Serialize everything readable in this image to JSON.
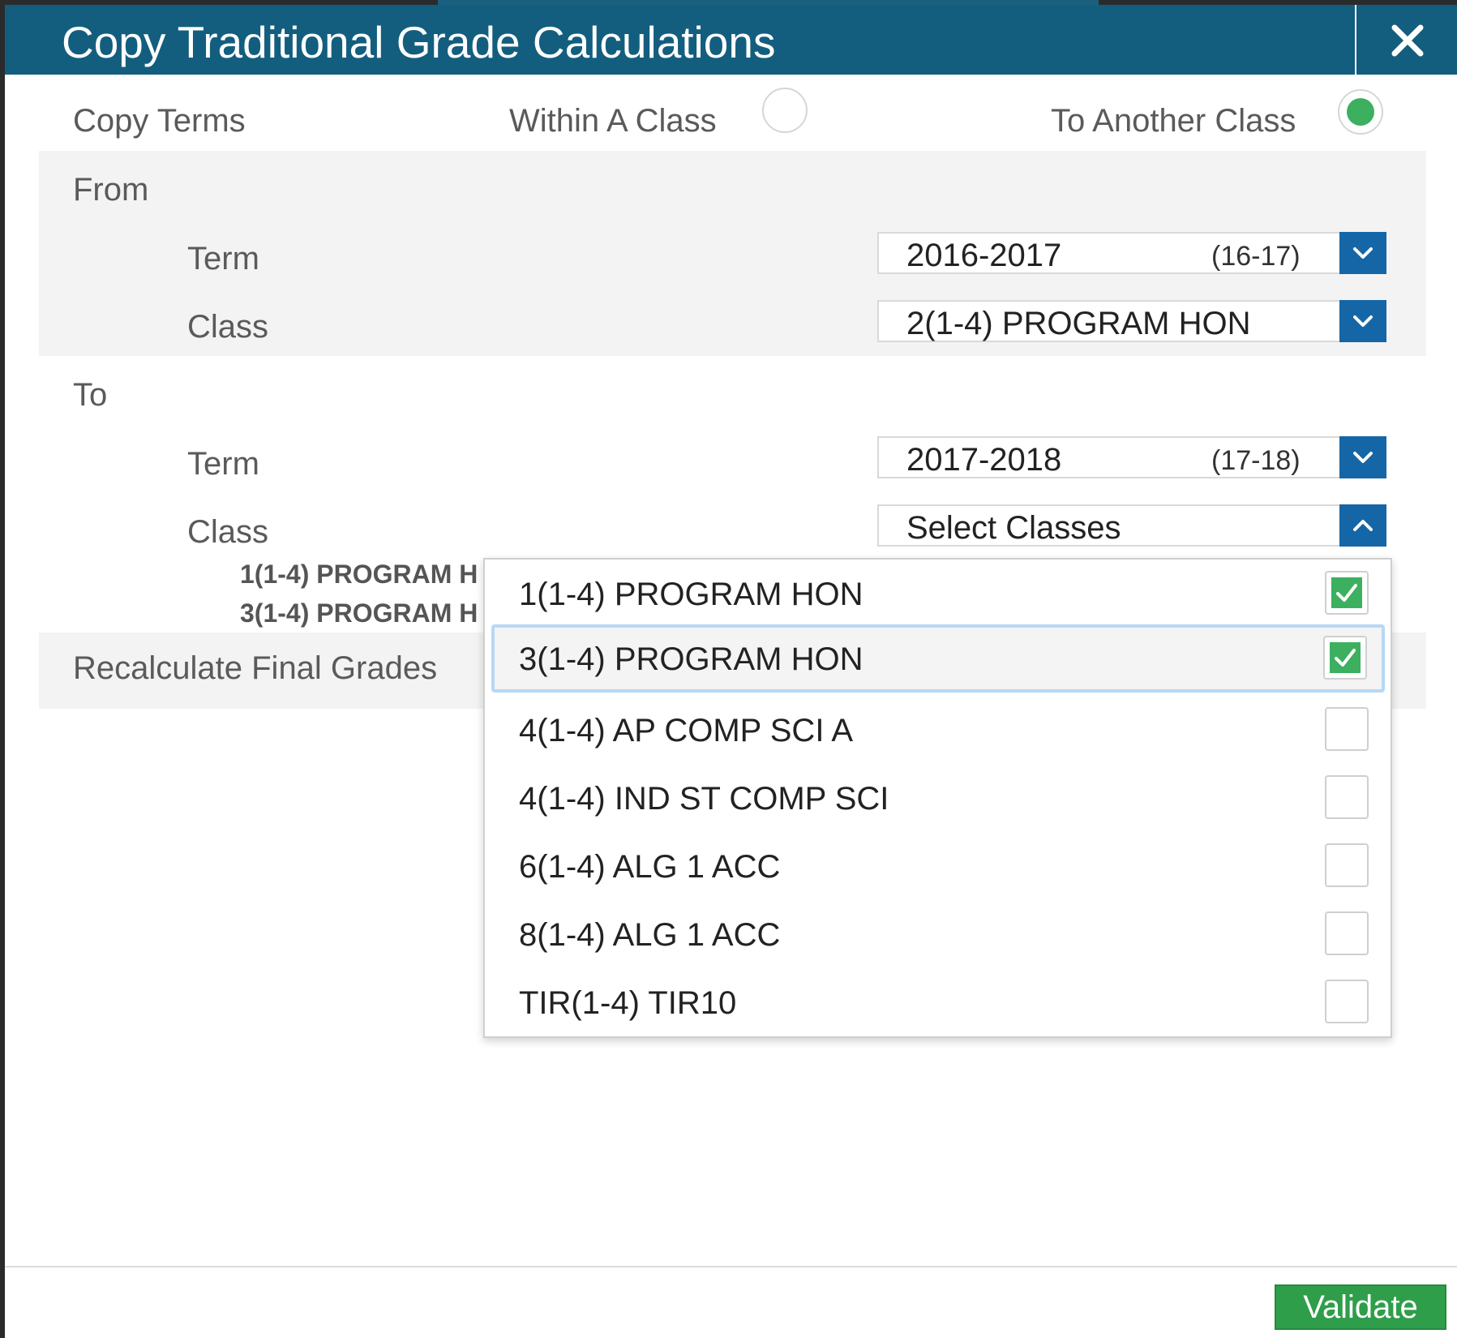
{
  "dialog": {
    "title": "Copy Traditional Grade Calculations",
    "copy_terms_label": "Copy Terms",
    "within_class_label": "Within A Class",
    "another_class_label": "To Another Class",
    "within_class_selected": false,
    "another_class_selected": true
  },
  "from": {
    "heading": "From",
    "term_label": "Term",
    "term_value": "2016-2017",
    "term_code": "(16-17)",
    "class_label": "Class",
    "class_value": "2(1-4) PROGRAM HON"
  },
  "to": {
    "heading": "To",
    "term_label": "Term",
    "term_value": "2017-2018",
    "term_code": "(17-18)",
    "class_label": "Class",
    "class_placeholder": "Select Classes",
    "selected_classes": [
      "1(1-4) PROGRAM H",
      "3(1-4) PROGRAM H"
    ]
  },
  "recalculate_label": "Recalculate Final Grades",
  "class_options": [
    {
      "label": "1(1-4) PROGRAM HON",
      "checked": true
    },
    {
      "label": "3(1-4) PROGRAM HON",
      "checked": true
    },
    {
      "label": "4(1-4) AP COMP SCI A",
      "checked": false
    },
    {
      "label": "4(1-4) IND ST COMP SCI",
      "checked": false
    },
    {
      "label": "6(1-4) ALG 1 ACC",
      "checked": false
    },
    {
      "label": "8(1-4) ALG 1 ACC",
      "checked": false
    },
    {
      "label": "TIR(1-4) TIR10",
      "checked": false
    }
  ],
  "footer": {
    "validate_label": "Validate"
  },
  "colors": {
    "titlebar": "#135e7f",
    "accent_green": "#3cb05f",
    "select_arrow": "#1566a6"
  }
}
